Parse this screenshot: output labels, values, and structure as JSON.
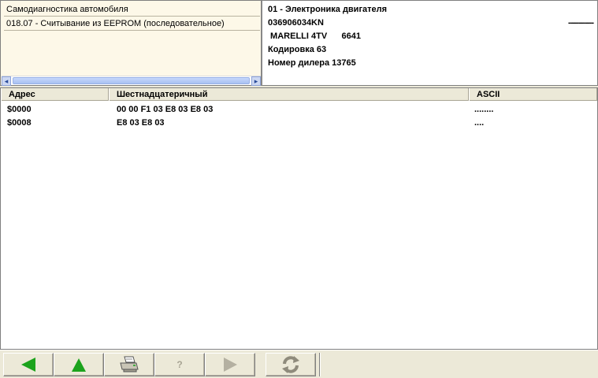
{
  "nav": {
    "items": [
      "Самодиагностика автомобиля",
      "018.07 - Считывание из EEPROM (последовательное)"
    ]
  },
  "info": {
    "lines": [
      "01 - Электроника двигателя",
      "036906034KN",
      " MARELLI 4TV      6641",
      "Кодировка 63",
      "Номер дилера 13765"
    ],
    "dash": "------------"
  },
  "grid": {
    "columns": [
      "Адрес",
      "Шестнадцатеричный",
      "ASCII"
    ],
    "rows": [
      {
        "addr": "$0000",
        "hex": "00 00 F1 03 E8 03 E8 03",
        "ascii": "........"
      },
      {
        "addr": "$0008",
        "hex": "E8 03 E8 03",
        "ascii": "...."
      }
    ]
  },
  "toolbar": {
    "buttons": [
      {
        "name": "back",
        "icon": "back-arrow-icon",
        "color": "#1aa01a"
      },
      {
        "name": "up",
        "icon": "up-arrow-icon",
        "color": "#1aa01a"
      },
      {
        "name": "print",
        "icon": "printer-icon"
      },
      {
        "name": "help",
        "icon": "help-icon",
        "label": "?"
      },
      {
        "name": "forward",
        "icon": "forward-arrow-icon"
      },
      {
        "name": "refresh",
        "icon": "refresh-icon"
      }
    ]
  }
}
